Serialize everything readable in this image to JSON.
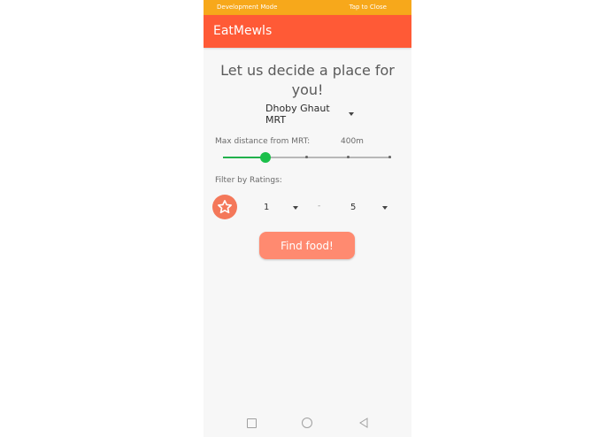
{
  "dev_bar": {
    "left_text": "Development Mode",
    "right_text": "Tap to Close"
  },
  "app_bar": {
    "title": "EatMewls"
  },
  "main": {
    "headline_line1": "Let us decide a place for",
    "headline_line2": "you!",
    "mrt_selected": "Dhoby Ghaut MRT",
    "distance_label": "Max distance from MRT:",
    "distance_value": "400m",
    "distance_slider_level_fraction": 0.25,
    "ratings_label": "Filter by Ratings:",
    "rating_min": "1",
    "rating_separator": "-",
    "rating_max": "5",
    "find_button_label": "Find food!"
  },
  "colors": {
    "dev_bar": "#f7a81b",
    "app_bar": "#ff5a36",
    "accent_green": "#1bbf4a",
    "button": "#ff8a70",
    "star_circle": "#f4785a"
  },
  "icons": {
    "star": "star-icon",
    "caret": "caret-down-icon",
    "nav_recent": "square-icon",
    "nav_home": "circle-icon",
    "nav_back": "triangle-back-icon"
  }
}
